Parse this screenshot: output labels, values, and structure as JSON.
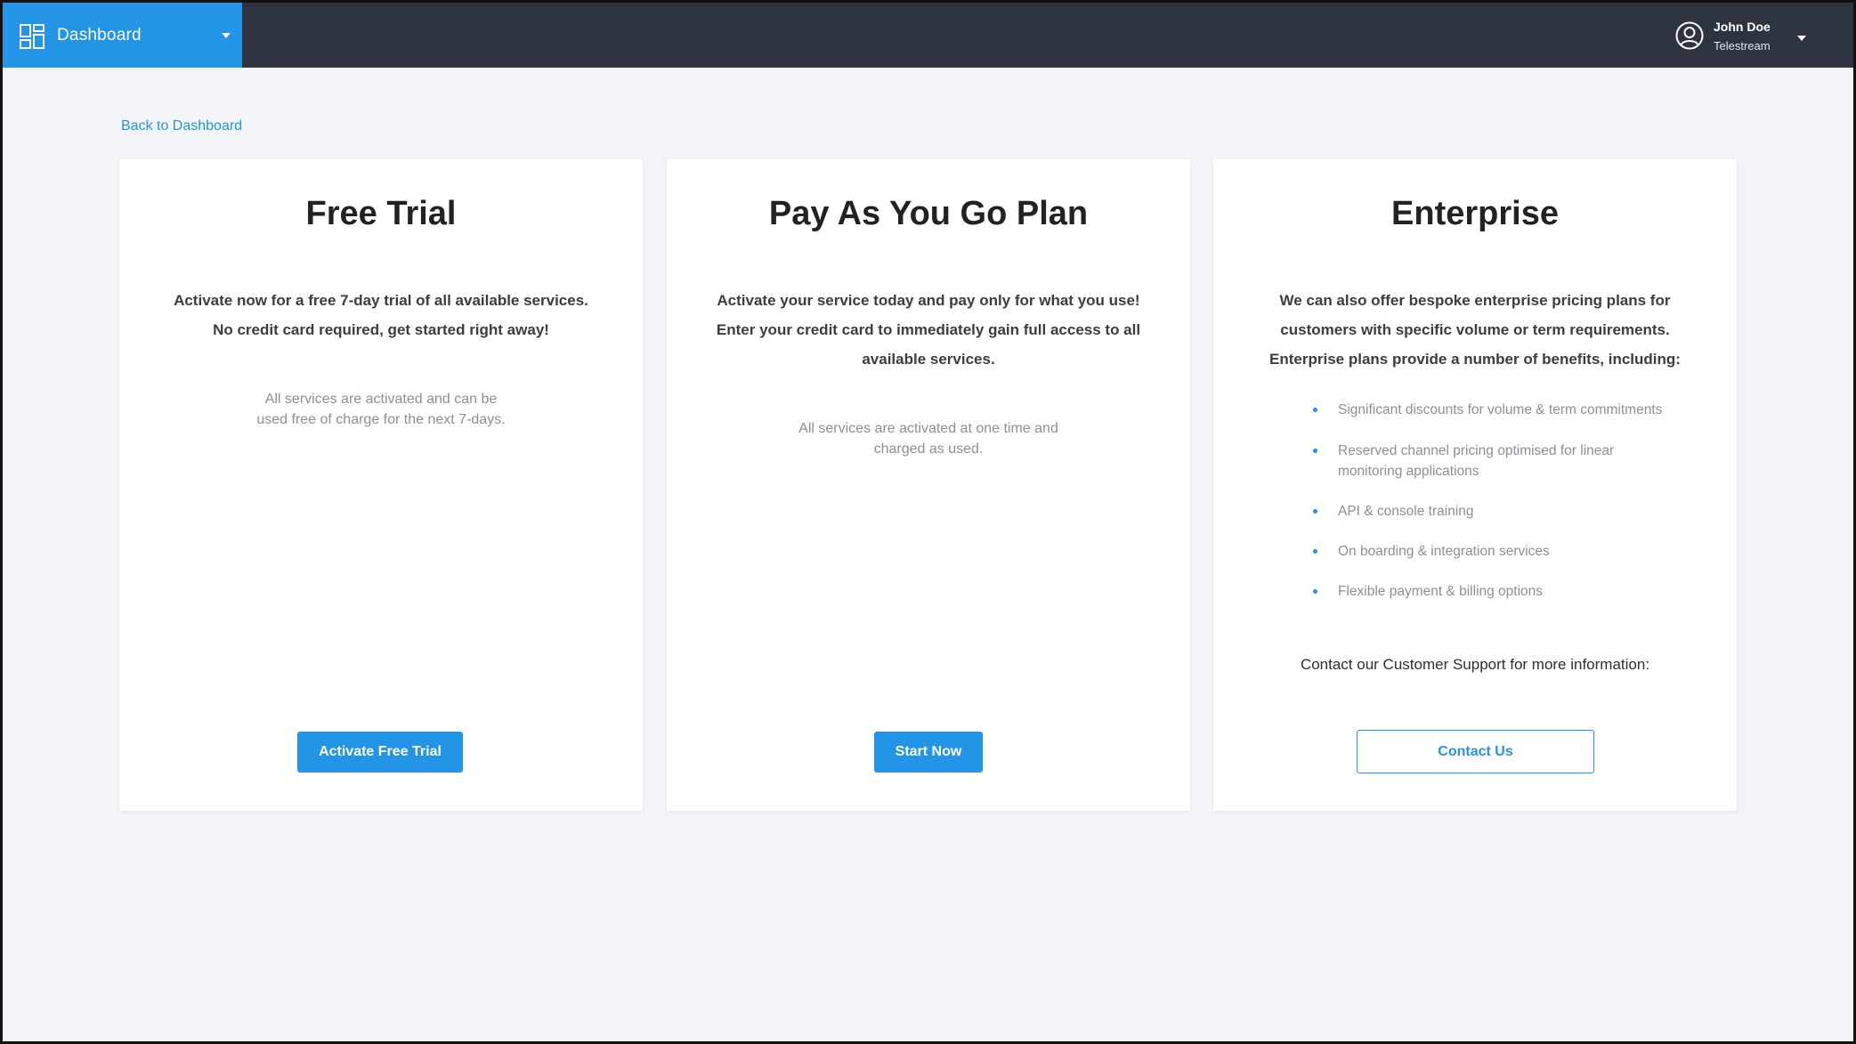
{
  "topbar": {
    "nav_label": "Dashboard",
    "nav_icon": "dashboard-grid-icon",
    "user_name": "John Doe",
    "user_org": "Telestream",
    "user_icon": "user-avatar-icon"
  },
  "back_link": "Back to Dashboard",
  "cards": {
    "free_trial": {
      "title": "Free Trial",
      "lead": [
        "Activate now for a free 7-day trial of all available services.",
        "No credit card required, get started right away!"
      ],
      "note": [
        "All services are activated and can be",
        "used free of charge for the next 7-days."
      ],
      "button": "Activate Free Trial"
    },
    "pay_as_you_go": {
      "title": "Pay As You Go Plan",
      "lead": [
        "Activate your service today and pay only for what you use!",
        "Enter your credit card to immediately gain full access to all",
        "available services."
      ],
      "note": [
        "All services are activated at one time and",
        "charged as used."
      ],
      "button": "Start Now"
    },
    "enterprise": {
      "title": "Enterprise",
      "lead": [
        "We can also offer bespoke enterprise pricing plans for",
        "customers with specific volume or term requirements.",
        "Enterprise plans provide a number of benefits, including:"
      ],
      "benefits": [
        "Significant discounts for volume & term commitments",
        "Reserved channel pricing optimised for linear monitoring applications",
        "API & console training",
        "On boarding & integration services",
        "Flexible payment & billing options"
      ],
      "contact_text": "Contact our Customer Support for more information:",
      "button": "Contact Us"
    }
  },
  "colors": {
    "accent": "#2394e6",
    "topbar": "#2d3440",
    "page_background": "#f3f4f8"
  }
}
